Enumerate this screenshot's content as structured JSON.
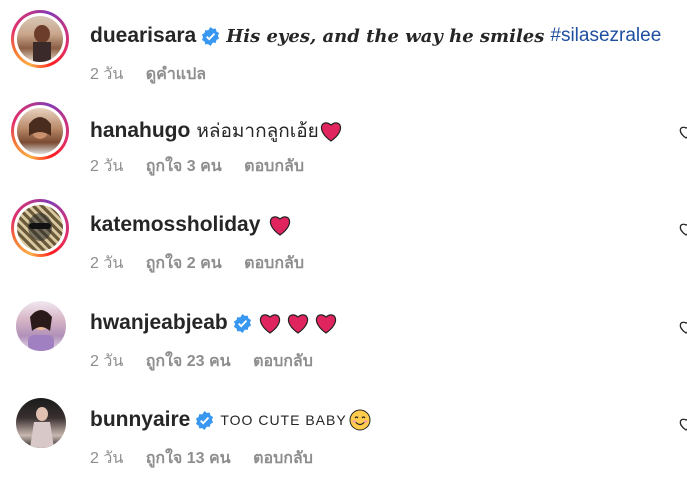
{
  "comments": [
    {
      "username": "duearisara",
      "verified": true,
      "text": "His eyes, and the way he smiles",
      "hashtag": "#silasezralee",
      "time": "2 วัน",
      "likes": "",
      "action": "ดูคำแปล"
    },
    {
      "username": "hanahugo",
      "verified": false,
      "text": "หล่อมากลูกเอ้ย",
      "time": "2 วัน",
      "likes": "ถูกใจ 3 คน",
      "action": "ตอบกลับ"
    },
    {
      "username": "katemossholiday",
      "verified": false,
      "text": "",
      "time": "2 วัน",
      "likes": "ถูกใจ 2 คน",
      "action": "ตอบกลับ"
    },
    {
      "username": "hwanjeabjeab",
      "verified": true,
      "text": "",
      "time": "2 วัน",
      "likes": "ถูกใจ 23 คน",
      "action": "ตอบกลับ"
    },
    {
      "username": "bunnyaire",
      "verified": true,
      "text": "TOO CUTE BABY",
      "time": "2 วัน",
      "likes": "ถูกใจ 13 คน",
      "action": "ตอบกลับ"
    }
  ],
  "colors": {
    "verified": "#3897f0",
    "heart": "#e0245e",
    "hashtag": "#1f4fa0",
    "muted": "#8e8e8e"
  }
}
